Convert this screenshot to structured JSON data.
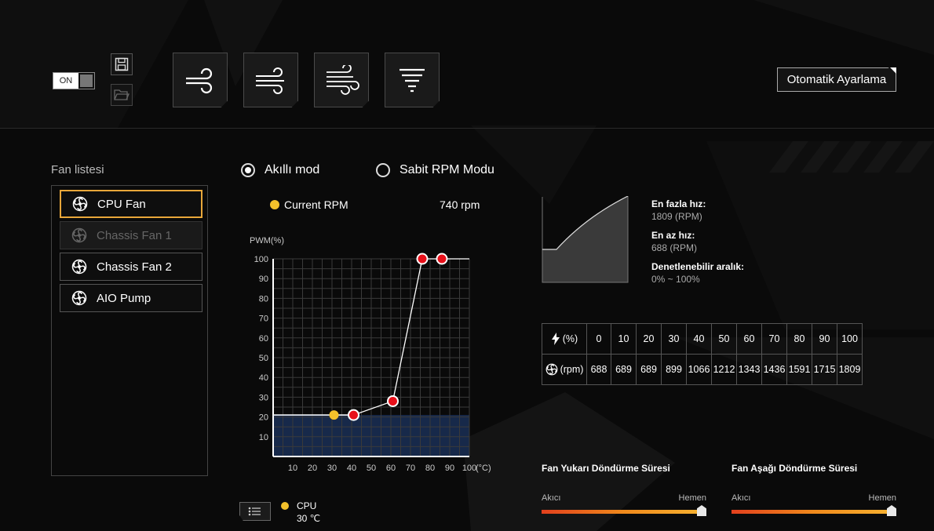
{
  "toolbar": {
    "toggle_label": "ON",
    "auto_button_label": "Otomatik Ayarlama"
  },
  "fan_list": {
    "title": "Fan listesi",
    "items": [
      {
        "label": "CPU Fan",
        "state": "selected"
      },
      {
        "label": "Chassis Fan 1",
        "state": "disabled"
      },
      {
        "label": "Chassis Fan 2",
        "state": "normal"
      },
      {
        "label": "AIO Pump",
        "state": "normal"
      }
    ]
  },
  "mode": {
    "smart_label": "Akıllı mod",
    "fixed_label": "Sabit RPM Modu",
    "selected": "smart"
  },
  "current_rpm": {
    "label": "Current RPM",
    "value": "740 rpm"
  },
  "chart_data": {
    "type": "line",
    "ylabel": "PWM(%)",
    "x_unit": "(°C)",
    "xlim": [
      0,
      100
    ],
    "ylim": [
      0,
      100
    ],
    "x_ticks": [
      10,
      20,
      30,
      40,
      50,
      60,
      70,
      80,
      90,
      100
    ],
    "y_ticks": [
      10,
      20,
      30,
      40,
      50,
      60,
      70,
      80,
      90,
      100
    ],
    "grid": true,
    "series": [
      {
        "points": [
          [
            0,
            21
          ],
          [
            41,
            21
          ],
          [
            61,
            28
          ],
          [
            76,
            100
          ],
          [
            86,
            100
          ],
          [
            100,
            100
          ]
        ],
        "color": "#ffffff"
      }
    ],
    "control_points": [
      [
        41,
        21
      ],
      [
        61,
        28
      ],
      [
        76,
        100
      ],
      [
        86,
        100
      ]
    ],
    "current_point": [
      31,
      21
    ],
    "current_level": 21,
    "colors": {
      "control": "#e8101a",
      "current": "#f3c12b",
      "fill": "#17294a"
    }
  },
  "legend": {
    "sensor_name": "CPU",
    "sensor_temp": "30 ℃"
  },
  "fan_info": {
    "max_label": "En fazla hız:",
    "max_value": "1809 (RPM)",
    "min_label": "En az hız:",
    "min_value": "688 (RPM)",
    "range_label": "Denetlenebilir aralık:",
    "range_value": "0% ~ 100%"
  },
  "rpm_table": {
    "pwm_header": "(%)",
    "rpm_header": "(rpm)",
    "pwm": [
      "0",
      "10",
      "20",
      "30",
      "40",
      "50",
      "60",
      "70",
      "80",
      "90",
      "100"
    ],
    "rpm": [
      "688",
      "689",
      "689",
      "899",
      "1066",
      "1212",
      "1343",
      "1436",
      "1591",
      "1715",
      "1809"
    ]
  },
  "spin_up": {
    "title": "Fan Yukarı Döndürme Süresi",
    "left": "Akıcı",
    "right": "Hemen",
    "level": 1.0
  },
  "spin_down": {
    "title": "Fan Aşağı Döndürme Süresi",
    "left": "Akıcı",
    "right": "Hemen",
    "level": 1.0
  },
  "colors": {
    "accent": "#e8a73a",
    "slider_start": "#e3401d",
    "slider_end": "#f7b431"
  }
}
